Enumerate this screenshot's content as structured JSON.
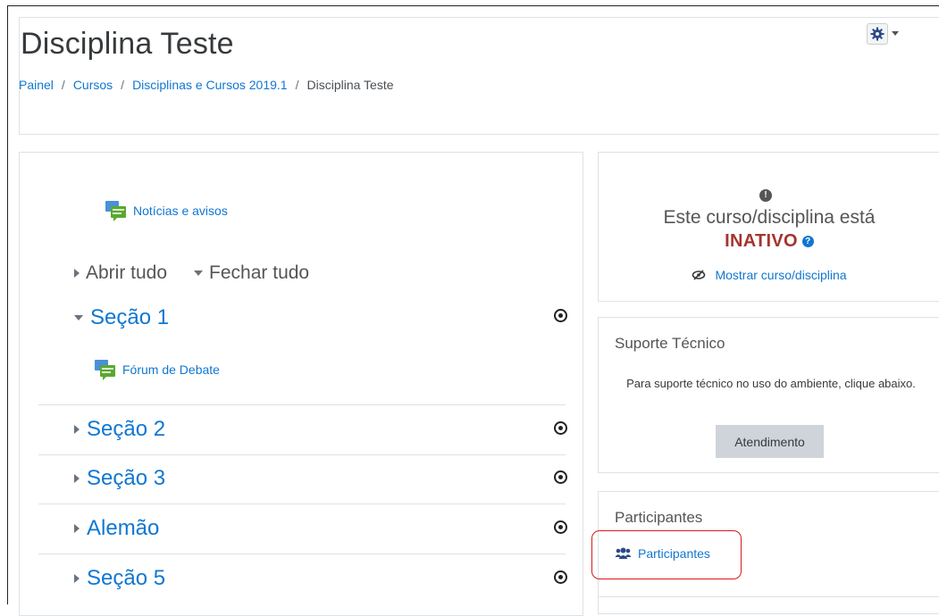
{
  "header": {
    "title": "Disciplina Teste",
    "breadcrumb": [
      "Painel",
      "Cursos",
      "Disciplinas e Cursos 2019.1",
      "Disciplina Teste"
    ],
    "breadcrumb_separator": "/",
    "settings_icon": "gear-icon"
  },
  "main": {
    "news_label": "Notícias e avisos",
    "expand_all": "Abrir tudo",
    "collapse_all": "Fechar tudo",
    "sections": [
      {
        "label": "Seção 1",
        "expanded": true,
        "activities": [
          {
            "label": "Fórum de Debate",
            "icon": "forum-icon"
          }
        ]
      },
      {
        "label": "Seção 2",
        "expanded": false
      },
      {
        "label": "Seção 3",
        "expanded": false
      },
      {
        "label": "Alemão",
        "expanded": false
      },
      {
        "label": "Seção 5",
        "expanded": false
      }
    ]
  },
  "sidebar": {
    "status": {
      "text": "Este curso/disciplina está",
      "state": "INATIVO",
      "show_link": "Mostrar curso/disciplina"
    },
    "support": {
      "title": "Suporte Técnico",
      "text": "Para suporte técnico no uso do ambiente, clique abaixo.",
      "button": "Atendimento"
    },
    "participants": {
      "title": "Participantes",
      "link": "Participantes"
    }
  },
  "colors": {
    "link": "#1177d1",
    "inactive": "#a5342e",
    "highlight": "#d7191c"
  }
}
